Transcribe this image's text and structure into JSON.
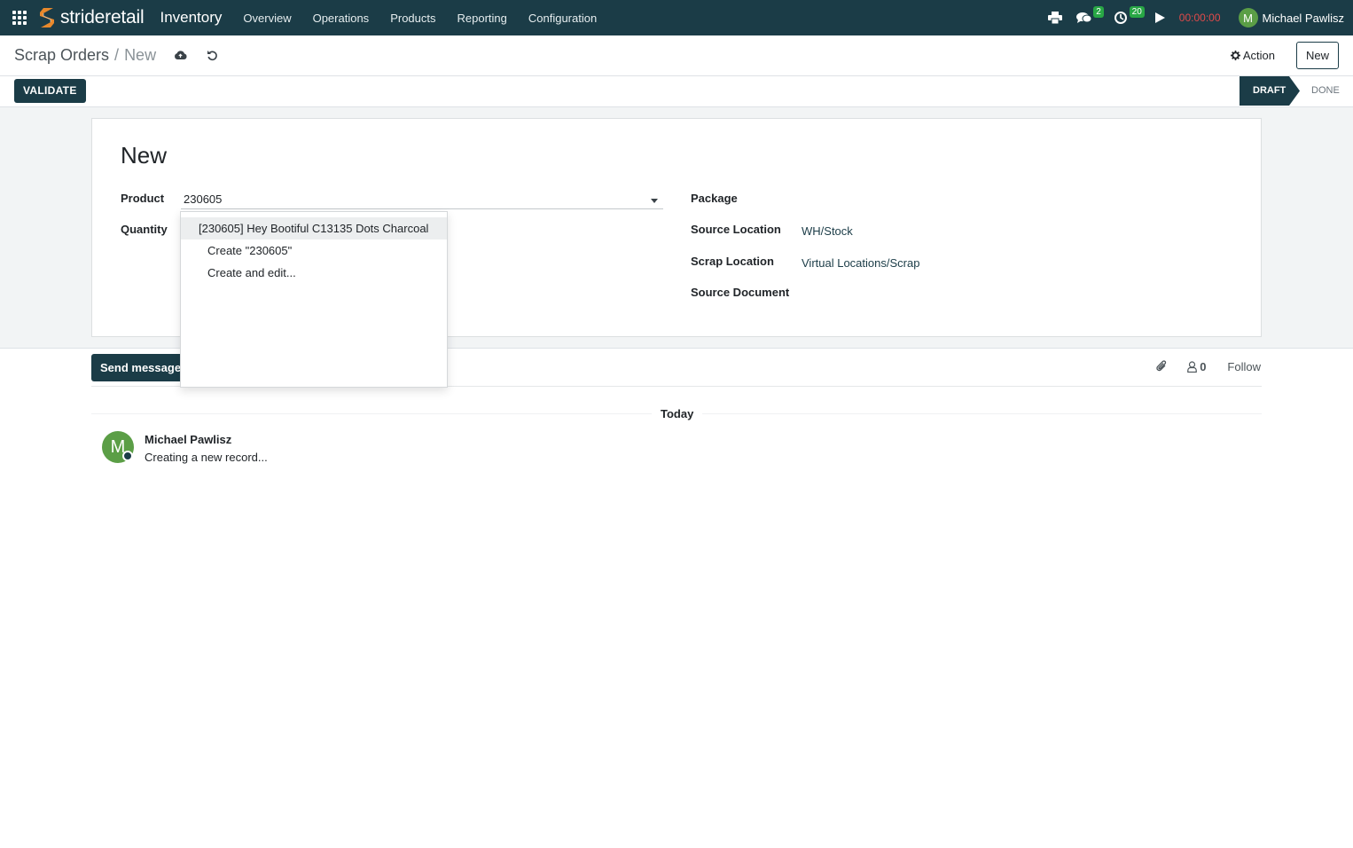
{
  "topbar": {
    "brand": {
      "name": "strideretail"
    },
    "app_name": "Inventory",
    "menu": [
      "Overview",
      "Operations",
      "Products",
      "Reporting",
      "Configuration"
    ],
    "messages_count": "2",
    "activities_count": "20",
    "timer": "00:00:00",
    "user_initial": "M",
    "user_name": "Michael Pawlisz"
  },
  "control": {
    "breadcrumb_parent": "Scrap Orders",
    "breadcrumb_separator": "/",
    "breadcrumb_current": "New",
    "action_label": "Action",
    "new_label": "New"
  },
  "statusbar": {
    "validate_label": "VALIDATE",
    "stages": [
      "DRAFT",
      "DONE"
    ],
    "active_stage": "DRAFT"
  },
  "form": {
    "title": "New",
    "product_label": "Product",
    "product_value": "230605",
    "quantity_label": "Quantity",
    "package_label": "Package",
    "source_location_label": "Source Location",
    "source_location_value": "WH/Stock",
    "scrap_location_label": "Scrap Location",
    "scrap_location_value": "Virtual Locations/Scrap",
    "source_document_label": "Source Document"
  },
  "dropdown": {
    "items": [
      "[230605] Hey Bootiful C13135 Dots Charcoal",
      "Create \"230605\"",
      "Create and edit..."
    ]
  },
  "chatter": {
    "send_label": "Send message",
    "followers_count": "0",
    "follow_label": "Follow",
    "date_label": "Today",
    "message": {
      "author_initial": "M",
      "author": "Michael Pawlisz",
      "body": "Creating a new record..."
    }
  },
  "colors": {
    "primary": "#1b3c47",
    "timer": "#e04a4a",
    "badge": "#28a745",
    "avatar": "#5b9e46",
    "brand_accent": "#e8892c"
  }
}
